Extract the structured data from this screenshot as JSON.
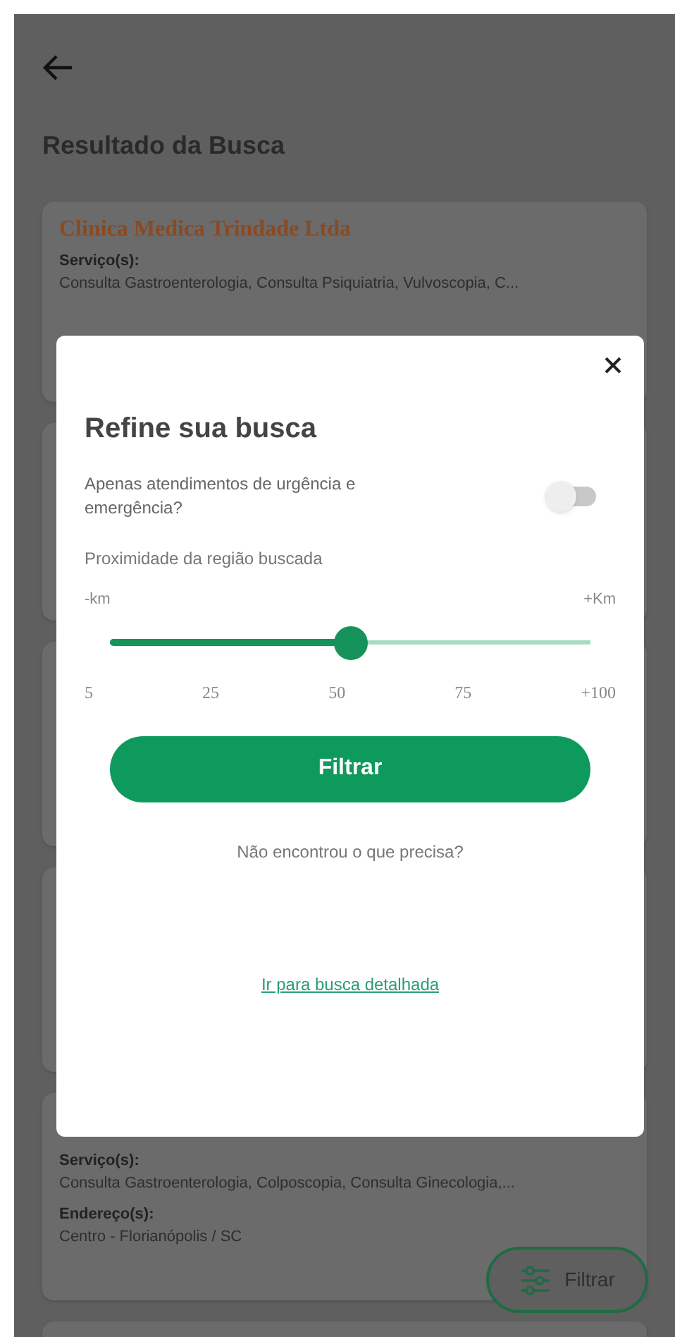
{
  "header": {
    "title": "Resultado da Busca"
  },
  "results": [
    {
      "name": "Clinica Medica Trindade Ltda",
      "services_label": "Serviço(s):",
      "services": "Consulta Gastroenterologia, Consulta Psiquiatria, Vulvoscopia, C..."
    },
    {
      "services_label": "Serviço(s):",
      "services": "Consulta Gastroenterologia, Colposcopia, Consulta Ginecologia,...",
      "address_label": "Endereço(s):",
      "address": "Centro - Florianópolis / SC"
    }
  ],
  "filter_modal": {
    "title": "Refine sua busca",
    "toggle": {
      "label": "Apenas atendimentos de urgência e emergência?",
      "on": false
    },
    "slider": {
      "label": "Proximidade da região buscada",
      "min_label": "-km",
      "max_label": "+Km",
      "level": 0.5,
      "ticks": [
        "5",
        "25",
        "50",
        "75",
        "+100"
      ]
    },
    "button": "Filtrar",
    "prompt": "Não encontrou o que precisa?",
    "link": "Ir para busca detalhada"
  },
  "fab": {
    "label": "Filtrar"
  }
}
